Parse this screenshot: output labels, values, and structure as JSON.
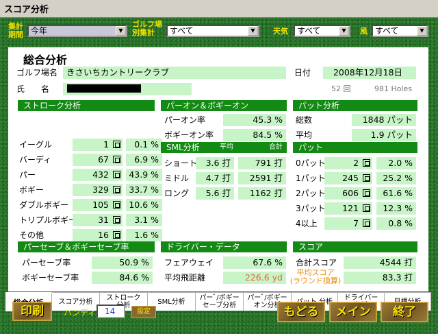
{
  "window": {
    "title": "スコア分析"
  },
  "filters": {
    "period_label": "集計\n期間",
    "period_value": "今年",
    "course_label": "ゴルフ場\n別集計",
    "course_value": "すべて",
    "weather_label": "天気",
    "weather_value": "すべて",
    "wind_label": "風",
    "wind_value": "すべて"
  },
  "summary": {
    "heading": "総合分析",
    "course_label": "ゴルフ場名",
    "course_value": "きさいちカントリークラブ",
    "date_label": "日付",
    "date_value": "2008年12月18日",
    "name_label": "氏　　名",
    "rounds": "52 回",
    "holes": "981 Holes"
  },
  "stroke": {
    "title": "ストローク分析",
    "unit": "回",
    "rows": [
      {
        "label": "イーグル",
        "count": "1",
        "pct": "0.1 %"
      },
      {
        "label": "バーディ",
        "count": "67",
        "pct": "6.9 %"
      },
      {
        "label": "パー",
        "count": "432",
        "pct": "43.9 %"
      },
      {
        "label": "ボギー",
        "count": "329",
        "pct": "33.7 %"
      },
      {
        "label": "ダブルボギー",
        "count": "105",
        "pct": "10.6 %"
      },
      {
        "label": "トリプルボギー",
        "count": "31",
        "pct": "3.1 %"
      },
      {
        "label": "その他",
        "count": "16",
        "pct": "1.6 %"
      }
    ]
  },
  "paron": {
    "title": "パーオン＆ボギーオン",
    "par_label": "パーオン率",
    "par_value": "45.3 %",
    "bogey_label": "ボギーオン率",
    "bogey_value": "84.5 %"
  },
  "sml": {
    "title": "SML分析",
    "col_avg": "平均",
    "col_total": "合計",
    "unit": "打",
    "rows": [
      {
        "label": "ショート",
        "avg": "3.6",
        "total": "791"
      },
      {
        "label": "ミドル",
        "avg": "4.7",
        "total": "2591"
      },
      {
        "label": "ロング",
        "avg": "5.6",
        "total": "1162"
      }
    ]
  },
  "putt_analysis": {
    "title": "パット分析",
    "total_label": "総数",
    "total_value": "1848 パット",
    "avg_label": "平均",
    "avg_value": "1.9 パット"
  },
  "putt": {
    "title": "パット",
    "unit": "回",
    "rows": [
      {
        "label": "0パット",
        "count": "2",
        "pct": "2.0 %"
      },
      {
        "label": "1パット",
        "count": "245",
        "pct": "25.2 %"
      },
      {
        "label": "2パット",
        "count": "606",
        "pct": "61.6 %"
      },
      {
        "label": "3パット",
        "count": "121",
        "pct": "12.3 %"
      },
      {
        "label": "4以上",
        "count": "7",
        "pct": "0.8 %"
      }
    ]
  },
  "parsave": {
    "title": "パーセーブ＆ボギーセーブ率",
    "par_label": "パーセーブ率",
    "par_value": "50.9 %",
    "bogey_label": "ボギーセーブ率",
    "bogey_value": "84.6 %"
  },
  "driver": {
    "title": "ドライバー・データ",
    "fairway_label": "フェアウェイ",
    "fairway_value": "67.6 %",
    "distance_label": "平均飛距離",
    "distance_value": "226.6 yd"
  },
  "score": {
    "title": "スコア",
    "total_label": "合計スコア",
    "total_value": "4544 打",
    "avg_label": "平均スコア\n(ラウンド換算)",
    "avg_value": "83.3 打"
  },
  "tabs": [
    "総合分析",
    "スコア分析",
    "ストローク\n分析",
    "SML分析",
    "パーﾞ/ボギー\nセーブ分析",
    "パーﾞ/ボギー\nオン分析",
    "パット 分析",
    "ドライバー\n分析",
    "目標分析"
  ],
  "footer": {
    "print_label": "印刷",
    "handicap_label": "ハンディ",
    "handicap_value": "14",
    "settings_label": "設定",
    "back_label": "もどる",
    "main_label": "メイン",
    "exit_label": "終了"
  },
  "colors": {
    "accent_green": "#138a13",
    "value_bg": "#c8f5c8",
    "label_yellow": "#f0e000"
  }
}
